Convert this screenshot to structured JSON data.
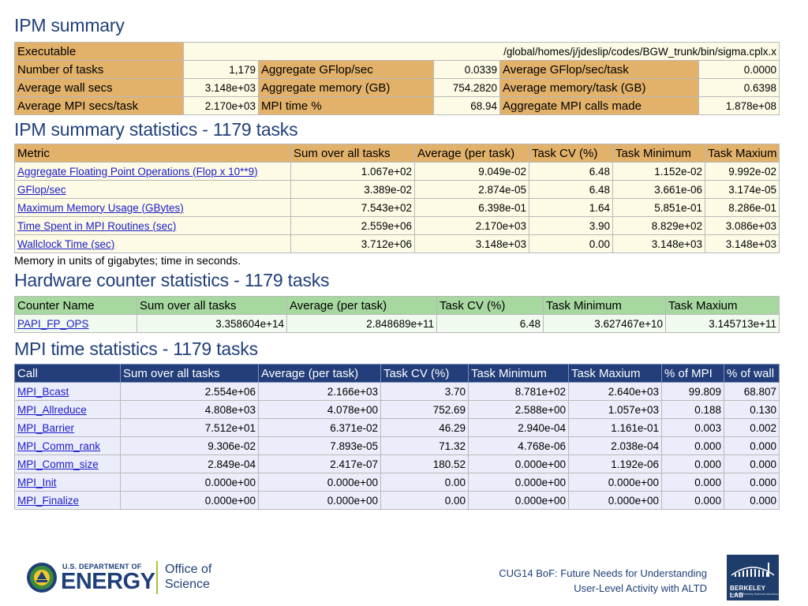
{
  "ipm_summary": {
    "title": "IPM summary",
    "executable_label": "Executable",
    "executable_value": "/global/homes/j/jdeslip/codes/BGW_trunk/bin/sigma.cplx.x",
    "rows": [
      [
        {
          "label": "Number of tasks",
          "value": "1,179"
        },
        {
          "label": "Aggregate GFlop/sec",
          "value": "0.0339"
        },
        {
          "label": "Average GFlop/sec/task",
          "value": "0.0000"
        }
      ],
      [
        {
          "label": "Average wall secs",
          "value": "3.148e+03"
        },
        {
          "label": "Aggregate memory (GB)",
          "value": "754.2820"
        },
        {
          "label": "Average memory/task (GB)",
          "value": "0.6398"
        }
      ],
      [
        {
          "label": "Average MPI secs/task",
          "value": "2.170e+03"
        },
        {
          "label": "MPI time %",
          "value": "68.94"
        },
        {
          "label": "Aggregate MPI calls made",
          "value": "1.878e+08"
        }
      ]
    ]
  },
  "summary_stats": {
    "title": "IPM summary statistics - 1179 tasks",
    "headers": [
      "Metric",
      "Sum over all tasks",
      "Average (per task)",
      "Task CV (%)",
      "Task Minimum",
      "Task Maxium"
    ],
    "rows": [
      [
        "Aggregate Floating Point Operations (Flop x 10**9)",
        "1.067e+02",
        "9.049e-02",
        "6.48",
        "1.152e-02",
        "9.992e-02"
      ],
      [
        "GFlop/sec",
        "3.389e-02",
        "2.874e-05",
        "6.48",
        "3.661e-06",
        "3.174e-05"
      ],
      [
        "Maximum Memory Usage (GBytes)",
        "7.543e+02",
        "6.398e-01",
        "1.64",
        "5.851e-01",
        "8.286e-01"
      ],
      [
        "Time Spent in MPI Routines (sec)",
        "2.559e+06",
        "2.170e+03",
        "3.90",
        "8.829e+02",
        "3.086e+03"
      ],
      [
        "Wallclock Time (sec)",
        "3.712e+06",
        "3.148e+03",
        "0.00",
        "3.148e+03",
        "3.148e+03"
      ]
    ],
    "note": "Memory in units of gigabytes; time in seconds."
  },
  "hardware_stats": {
    "title": "Hardware counter statistics - 1179 tasks",
    "headers": [
      "Counter Name",
      "Sum over all tasks",
      "Average (per task)",
      "Task CV (%)",
      "Task Minimum",
      "Task Maxium"
    ],
    "rows": [
      [
        "PAPI_FP_OPS",
        "3.358604e+14",
        "2.848689e+11",
        "6.48",
        "3.627467e+10",
        "3.145713e+11"
      ]
    ]
  },
  "mpi_stats": {
    "title": "MPI time statistics - 1179 tasks",
    "headers": [
      "Call",
      "Sum over all tasks",
      "Average (per task)",
      "Task CV (%)",
      "Task Minimum",
      "Task Maxium",
      "% of MPI",
      "% of wall"
    ],
    "rows": [
      [
        "MPI_Bcast",
        "2.554e+06",
        "2.166e+03",
        "3.70",
        "8.781e+02",
        "2.640e+03",
        "99.809",
        "68.807"
      ],
      [
        "MPI_Allreduce",
        "4.808e+03",
        "4.078e+00",
        "752.69",
        "2.588e+00",
        "1.057e+03",
        "0.188",
        "0.130"
      ],
      [
        "MPI_Barrier",
        "7.512e+01",
        "6.371e-02",
        "46.29",
        "2.940e-04",
        "1.161e-01",
        "0.003",
        "0.002"
      ],
      [
        "MPI_Comm_rank",
        "9.306e-02",
        "7.893e-05",
        "71.32",
        "4.768e-06",
        "2.038e-04",
        "0.000",
        "0.000"
      ],
      [
        "MPI_Comm_size",
        "2.849e-04",
        "2.417e-07",
        "180.52",
        "0.000e+00",
        "1.192e-06",
        "0.000",
        "0.000"
      ],
      [
        "MPI_Init",
        "0.000e+00",
        "0.000e+00",
        "0.00",
        "0.000e+00",
        "0.000e+00",
        "0.000",
        "0.000"
      ],
      [
        "MPI_Finalize",
        "0.000e+00",
        "0.000e+00",
        "0.00",
        "0.000e+00",
        "0.000e+00",
        "0.000",
        "0.000"
      ]
    ]
  },
  "footer": {
    "doe_small": "U.S. DEPARTMENT OF",
    "doe_big": "ENERGY",
    "office_line1": "Office of",
    "office_line2": "Science",
    "caption_line1": "CUG14 BoF: Future Needs for Understanding",
    "caption_line2": "User-Level Activity with ALTD",
    "lab_name": "BERKELEY LAB",
    "lab_sub": "Lawrence Berkeley National Laboratory"
  },
  "colors": {
    "title_blue": "#1f3f7a",
    "summary_header": "#e2b16a",
    "hardware_header": "#a6d8a0",
    "mpi_header": "#233e7a",
    "link": "#1c1cc9"
  }
}
